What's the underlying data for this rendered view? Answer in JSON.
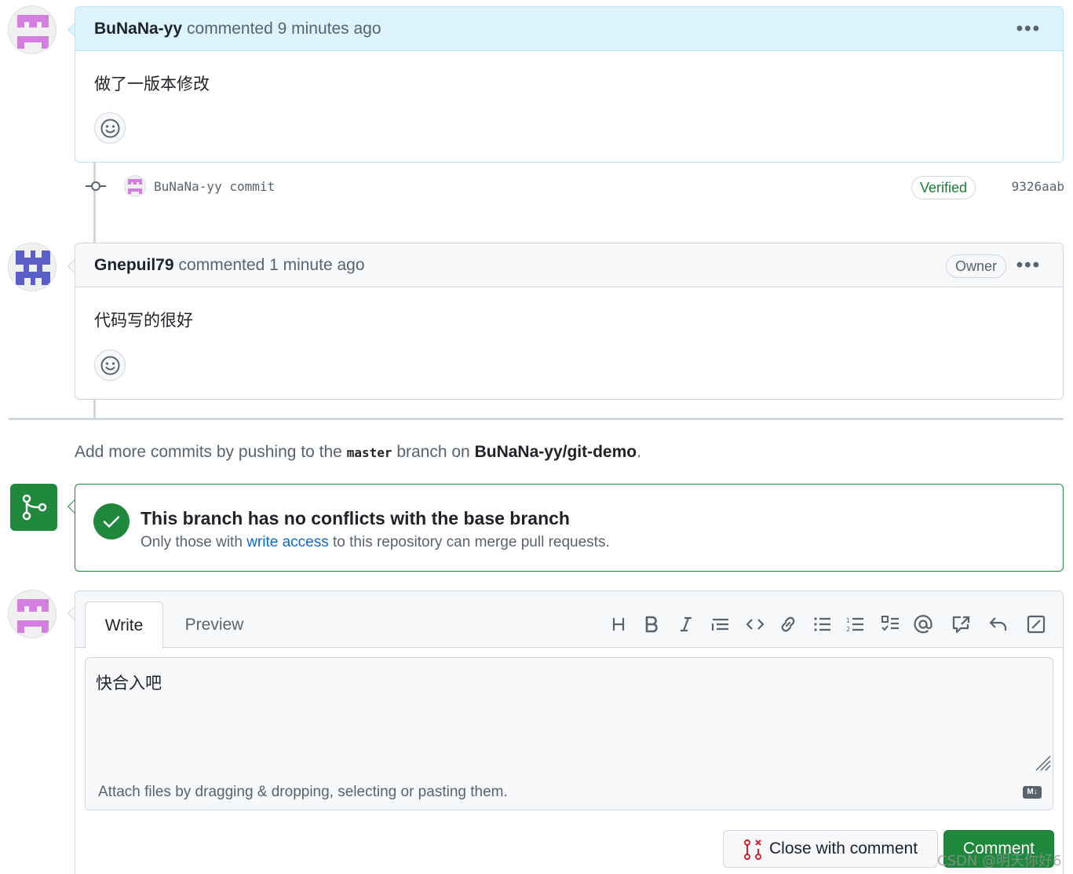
{
  "comments": [
    {
      "author": "BuNaNa-yy",
      "meta": "commented 9 minutes ago",
      "body": "做了一版本修改",
      "menu_label": "•••"
    },
    {
      "author": "Gnepuil79",
      "meta": "commented 1 minute ago",
      "badge": "Owner",
      "body": "代码写的很好",
      "menu_label": "•••"
    }
  ],
  "commit": {
    "text": "BuNaNa-yy commit",
    "verified_label": "Verified",
    "sha": "9326aab"
  },
  "info": {
    "prefix": "Add more commits by pushing to the",
    "branch": "master",
    "middle": "branch on",
    "repo": "BuNaNa-yy/git-demo",
    "suffix": "."
  },
  "merge": {
    "title": "This branch has no conflicts with the base branch",
    "sub_prefix": "Only those with",
    "link": "write access",
    "sub_suffix": "to this repository can merge pull requests."
  },
  "editor": {
    "tab_write": "Write",
    "tab_preview": "Preview",
    "value": "快合入吧",
    "attach_hint": "Attach files by dragging & dropping, selecting or pasting them.",
    "md_badge": "M↓"
  },
  "buttons": {
    "close_with_comment": "Close with comment",
    "comment": "Comment"
  },
  "watermark": "CSDN @明天你好6",
  "colors": {
    "accent_green": "#1f883d",
    "link_blue": "#0969da",
    "avatar_purple": "#d47fe0",
    "avatar_indigo": "#5a5fc7"
  }
}
